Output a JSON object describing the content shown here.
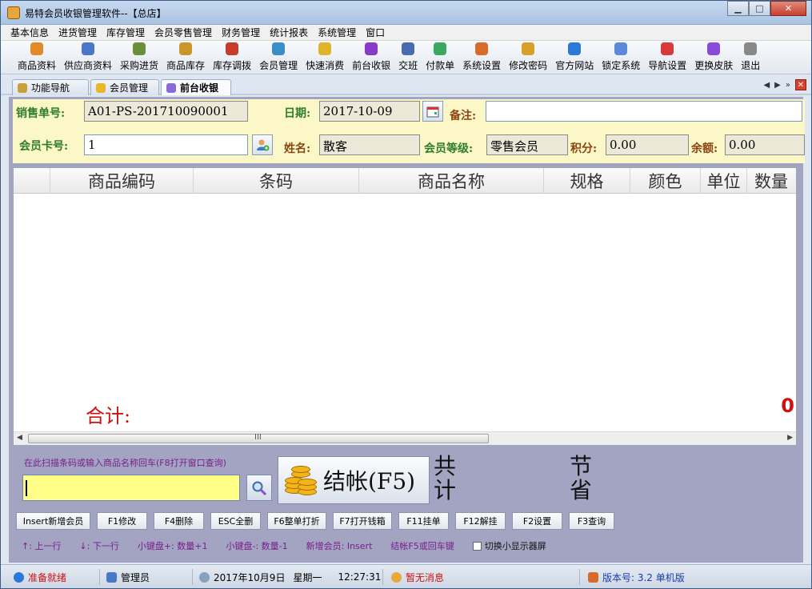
{
  "window": {
    "title": "易特会员收银管理软件--【总店】"
  },
  "menu": [
    "基本信息",
    "进货管理",
    "库存管理",
    "会员零售管理",
    "财务管理",
    "统计报表",
    "系统管理",
    "窗口"
  ],
  "toolbar": [
    {
      "label": "商品资料",
      "icon": "product-icon",
      "color": "#e08a2a"
    },
    {
      "label": "供应商资料",
      "icon": "supplier-icon",
      "color": "#4a78c8"
    },
    {
      "label": "采购进货",
      "icon": "truck-icon",
      "color": "#6b8e3a"
    },
    {
      "label": "商品库存",
      "icon": "box-icon",
      "color": "#c9962a"
    },
    {
      "label": "库存调拨",
      "icon": "transfer-icon",
      "color": "#c83a2a"
    },
    {
      "label": "会员管理",
      "icon": "member-icon",
      "color": "#3a8ec8"
    },
    {
      "label": "快速消费",
      "icon": "coin-icon",
      "color": "#e0b42a"
    },
    {
      "label": "前台收银",
      "icon": "cashier-icon",
      "color": "#8a3ac8"
    },
    {
      "label": "交班",
      "icon": "people-icon",
      "color": "#4a6ab0"
    },
    {
      "label": "付款单",
      "icon": "bill-icon",
      "color": "#3aa860"
    },
    {
      "label": "系统设置",
      "icon": "settings-icon",
      "color": "#d86a2a"
    },
    {
      "label": "修改密码",
      "icon": "key-icon",
      "color": "#d8a02a"
    },
    {
      "label": "官方网站",
      "icon": "ie-icon",
      "color": "#2a78d8"
    },
    {
      "label": "锁定系统",
      "icon": "lock-icon",
      "color": "#5a8ad8"
    },
    {
      "label": "导航设置",
      "icon": "nav-icon",
      "color": "#d83a3a"
    },
    {
      "label": "更换皮肤",
      "icon": "skin-icon",
      "color": "#8a4ad8"
    },
    {
      "label": "退出",
      "icon": "exit-icon",
      "color": "#888888"
    }
  ],
  "tabs": [
    {
      "label": "功能导航",
      "icon": "function-icon",
      "color": "#c8a03a"
    },
    {
      "label": "会员管理",
      "icon": "member-icon",
      "color": "#e8b82a"
    },
    {
      "label": "前台收银",
      "icon": "cashier-icon",
      "color": "#8a6ad8"
    }
  ],
  "form": {
    "order_no_label": "销售单号:",
    "order_no": "A01-PS-201710090001",
    "date_label": "日期:",
    "date": "2017-10-09",
    "note_label": "备注:",
    "note": "",
    "card_label": "会员卡号:",
    "card": "1",
    "name_label": "姓名:",
    "name": "散客",
    "level_label": "会员等级:",
    "level": "零售会员",
    "points_label": "积分:",
    "points": "0.00",
    "balance_label": "余额:",
    "balance": "0.00"
  },
  "grid": {
    "columns": [
      "商品编码",
      "条码",
      "商品名称",
      "规格",
      "颜色",
      "单位",
      "数量"
    ],
    "total_label": "合计:",
    "total_value": "0",
    "scroll_grip": "III"
  },
  "scan": {
    "hint": "在此扫描条码或输入商品名称回车(F8打开窗口查询)",
    "value": ""
  },
  "checkout": {
    "label": "结帐(F5)",
    "total_caption": "共计",
    "saving_caption": "节省"
  },
  "fkeys": [
    "Insert新增会员",
    "F1修改",
    "F4删除",
    "ESC全删",
    "F6整单打折",
    "F7打开钱箱",
    "F11挂单",
    "F12解挂",
    "F2设置",
    "F3查询"
  ],
  "hints": [
    "↑: 上一行",
    "↓: 下一行",
    "小键盘+: 数量+1",
    "小键盘-: 数量-1",
    "新增会员: Insert",
    "结帐F5或回车键"
  ],
  "toggle_label": "切换小显示器屏",
  "status": {
    "ready": "准备就绪",
    "user": "管理员",
    "date": "2017年10月9日",
    "weekday": "星期一",
    "time": "12:27:31",
    "message": "暂无消息",
    "version": "版本号: 3.2 单机版"
  },
  "colors": {
    "accent_red": "#d01010",
    "label_green": "#2e7d2e",
    "scan_yellow": "#ffff88",
    "panel_lavender": "#a3a3c2"
  }
}
